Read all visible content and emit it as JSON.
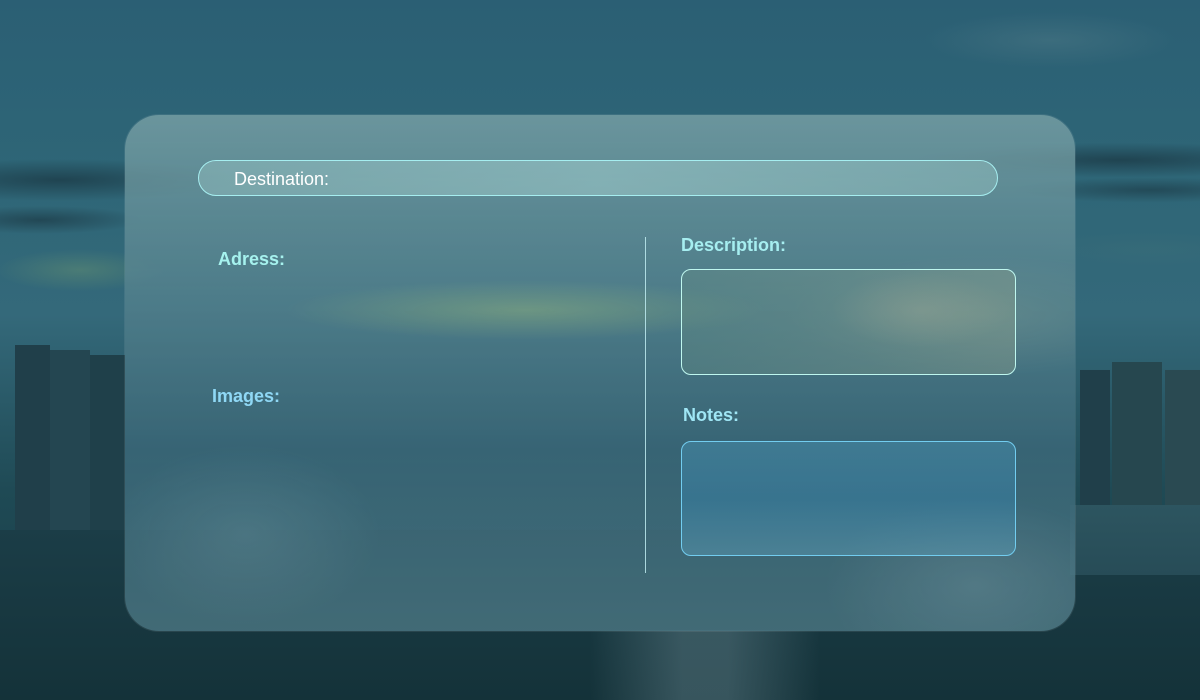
{
  "form": {
    "destination_label": "Destination:",
    "adress_label": "Adress:",
    "images_label": "Images:",
    "description_label": "Description:",
    "notes_label": "Notes:"
  },
  "colors": {
    "label_cyan": "#a6f2ee",
    "label_blue": "#8fd8f5",
    "field_border": "#a6eef0",
    "notes_border": "#72cdf0"
  }
}
